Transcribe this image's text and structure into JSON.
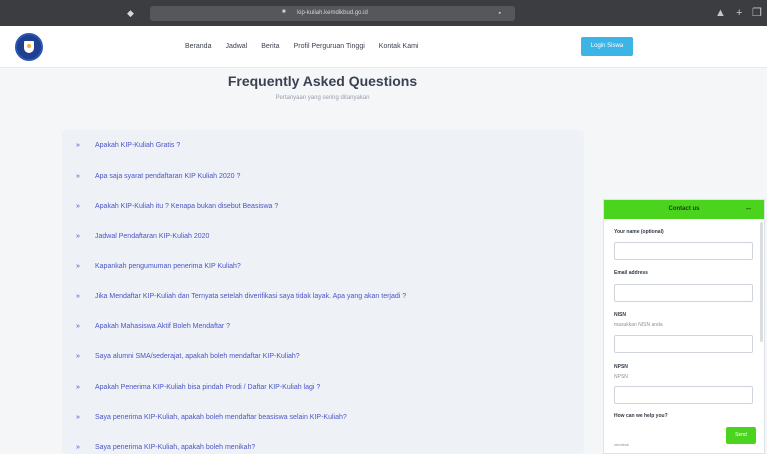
{
  "browser": {
    "url": "kip-kuliah.kemdikbud.go.id",
    "shield_icon": "shield-icon",
    "lock_icon": "lock-icon",
    "share_icon": "share-icon",
    "newtab_icon": "plus-icon",
    "tabs_icon": "tabs-icon"
  },
  "nav": {
    "logo_icon": "kemdikbud-logo",
    "links": [
      "Beranda",
      "Jadwal",
      "Berita",
      "Profil Perguruan Tinggi",
      "Kontak Kami"
    ],
    "login_label": "Login Siswa",
    "accent": "#3cb4e6"
  },
  "faq": {
    "title": "Frequently Asked Questions",
    "subtitle": "Pertanyaan yang sering ditanyakan",
    "arrow": "»",
    "questions": [
      "Apakah KIP-Kuliah Gratis ?",
      "Apa saja syarat pendaftaran KIP Kuliah 2020 ?",
      "Apakah KIP-Kuliah itu ? Kenapa bukan disebut Beasiswa ?",
      "Jadwal Pendaftaran KIP-Kuliah 2020",
      "Kapankah pengumuman penerima KIP Kuliah?",
      "Jika Mendaftar KIP-Kuliah dan Ternyata setelah diverifikasi saya tidak layak. Apa yang akan terjadi ?",
      "Apakah Mahasiswa Aktif Boleh Mendaftar ?",
      "Saya alumni SMA/sederajat, apakah boleh mendaftar KIP-Kuliah?",
      "Apakah Penerima KIP-Kuliah bisa pindah Prodi / Daftar KIP-Kuliah lagi ?",
      "Saya penerima KIP-Kuliah, apakah boleh mendaftar beasiswa selain KIP-Kuliah?",
      "Saya penerima KIP-Kuliah, apakah boleh menikah?"
    ],
    "link_color": "#4b55c8"
  },
  "contact": {
    "title": "Contact us",
    "minimize": "–",
    "name_label": "Your name (optional)",
    "email_label": "Email address",
    "nisn_label": "NISN",
    "nisn_hint": "masukkan NISN anda",
    "npsn_label": "NPSN",
    "npsn_hint": "NPSN",
    "help_label": "How can we help you?",
    "footer_text": "zendesk",
    "send_label": "Send",
    "accent": "#4bd41e"
  }
}
